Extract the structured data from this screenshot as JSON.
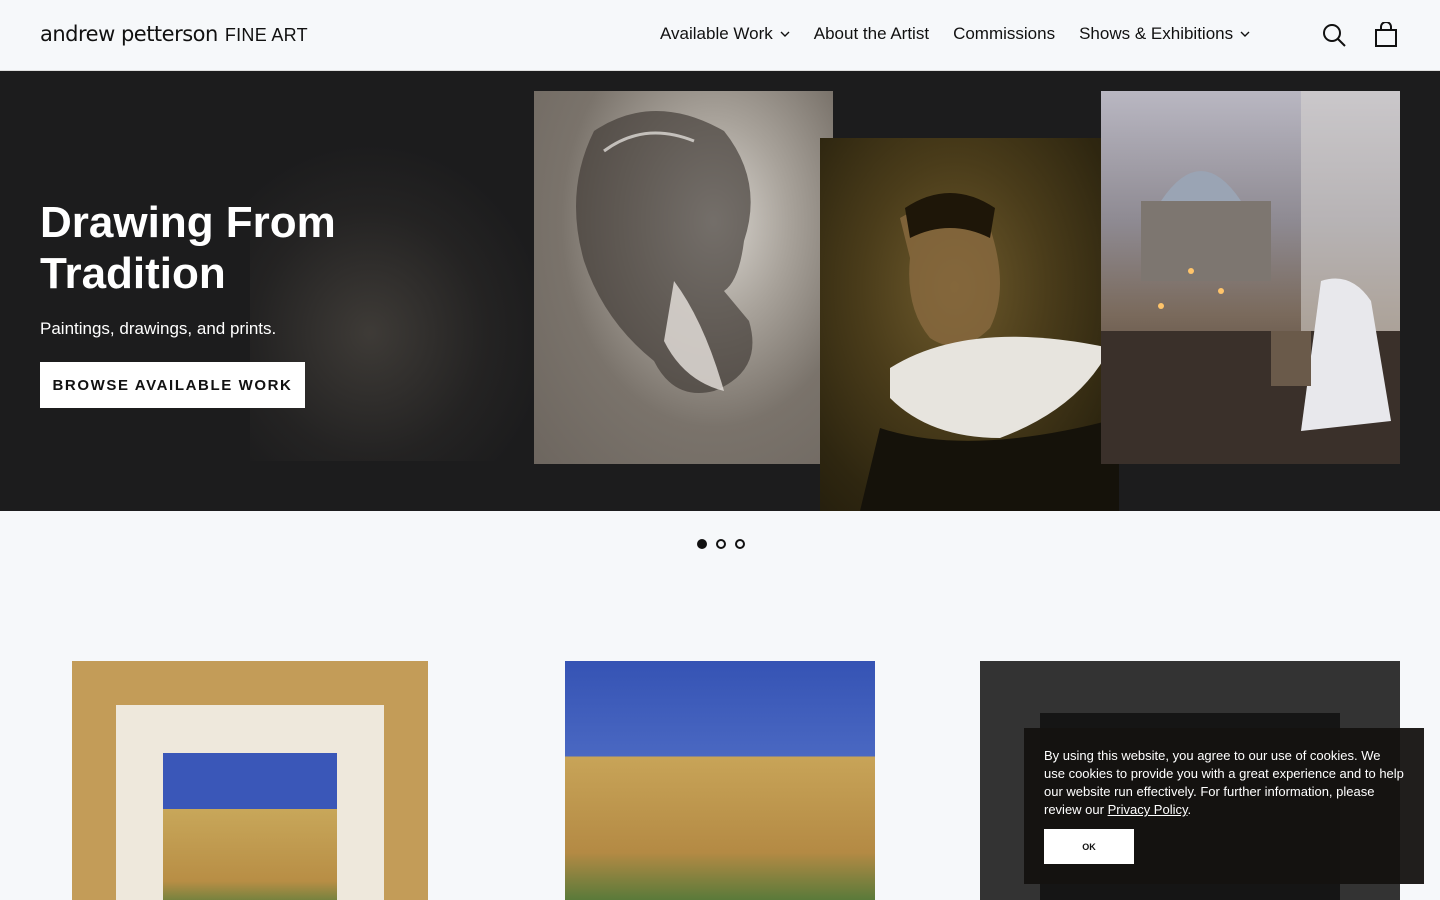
{
  "header": {
    "logo_main": "andrew petterson",
    "logo_sub": "FINE ART",
    "nav": [
      {
        "label": "Available Work",
        "dropdown": true
      },
      {
        "label": "About the Artist",
        "dropdown": false
      },
      {
        "label": "Commissions",
        "dropdown": false
      },
      {
        "label": "Shows & Exhibitions",
        "dropdown": true
      }
    ],
    "icons": [
      "search-icon",
      "cart-icon"
    ]
  },
  "hero": {
    "title": "Drawing From Tradition",
    "subtitle": "Paintings, drawings, and prints.",
    "button_label": "BROWSE AVAILABLE WORK",
    "background_color": "#1c1c1d"
  },
  "slider": {
    "dot_count": 3,
    "active_index": 0
  },
  "cookie_banner": {
    "text": "By using this website, you agree to our use of cookies. We use cookies to provide you with a great experience and to help our website run effectively. For further information, please review our ",
    "link_label": "Privacy Policy",
    "after_link": ".",
    "button_label": "OK"
  },
  "colors": {
    "page_background": "#f6f8fa",
    "text": "#111111",
    "button_background": "#ffffff"
  }
}
